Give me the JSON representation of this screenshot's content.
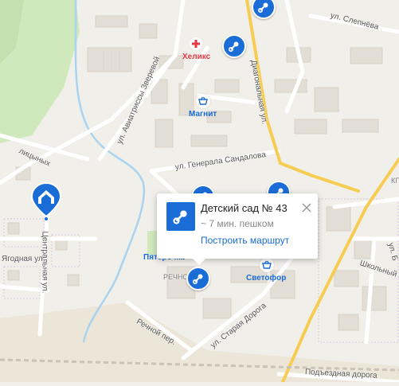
{
  "streets": {
    "slepneva": "ул. Слепнёва",
    "zverevoi": "ул. Авиатриссы Зверевой",
    "diagonalnaya": "Диагональная ул.",
    "sandalova": "ул. Генерала Сандалова",
    "tsentralnaya": "Центральная ул.",
    "yagodnaya": "Ягодная ул.",
    "shkolny": "Школьный пр.",
    "rechnoy": "Речной пер.",
    "staraya_doroga": "ул. Старая Дорога",
    "podyezdnaya": "Подъездная дорога",
    "partial_top_left": "лицыных",
    "partial_right": "ул. Б"
  },
  "pois": {
    "helix": "Хеликс",
    "magnit": "Магнит",
    "svetofor": "Светофор",
    "pyaterochka": "Пятёрочка",
    "rechnoe": "РЕЧНОЕ",
    "right_edge": "КГ"
  },
  "popup": {
    "title": "Детский сад № 43",
    "walk_time": "~ 7 мин. пешком",
    "route_link": "Построить маршрут"
  },
  "colors": {
    "accent": "#1a6dd6",
    "helix": "#e63946",
    "road_major": "#f6cc52",
    "forest": "#cfe8bc"
  },
  "icons": {
    "kindergarten": "pacifier-icon",
    "shop": "shopping-basket-icon",
    "clinic": "medical-cross-icon",
    "home": "home-location-pin-icon",
    "close": "close-icon"
  }
}
